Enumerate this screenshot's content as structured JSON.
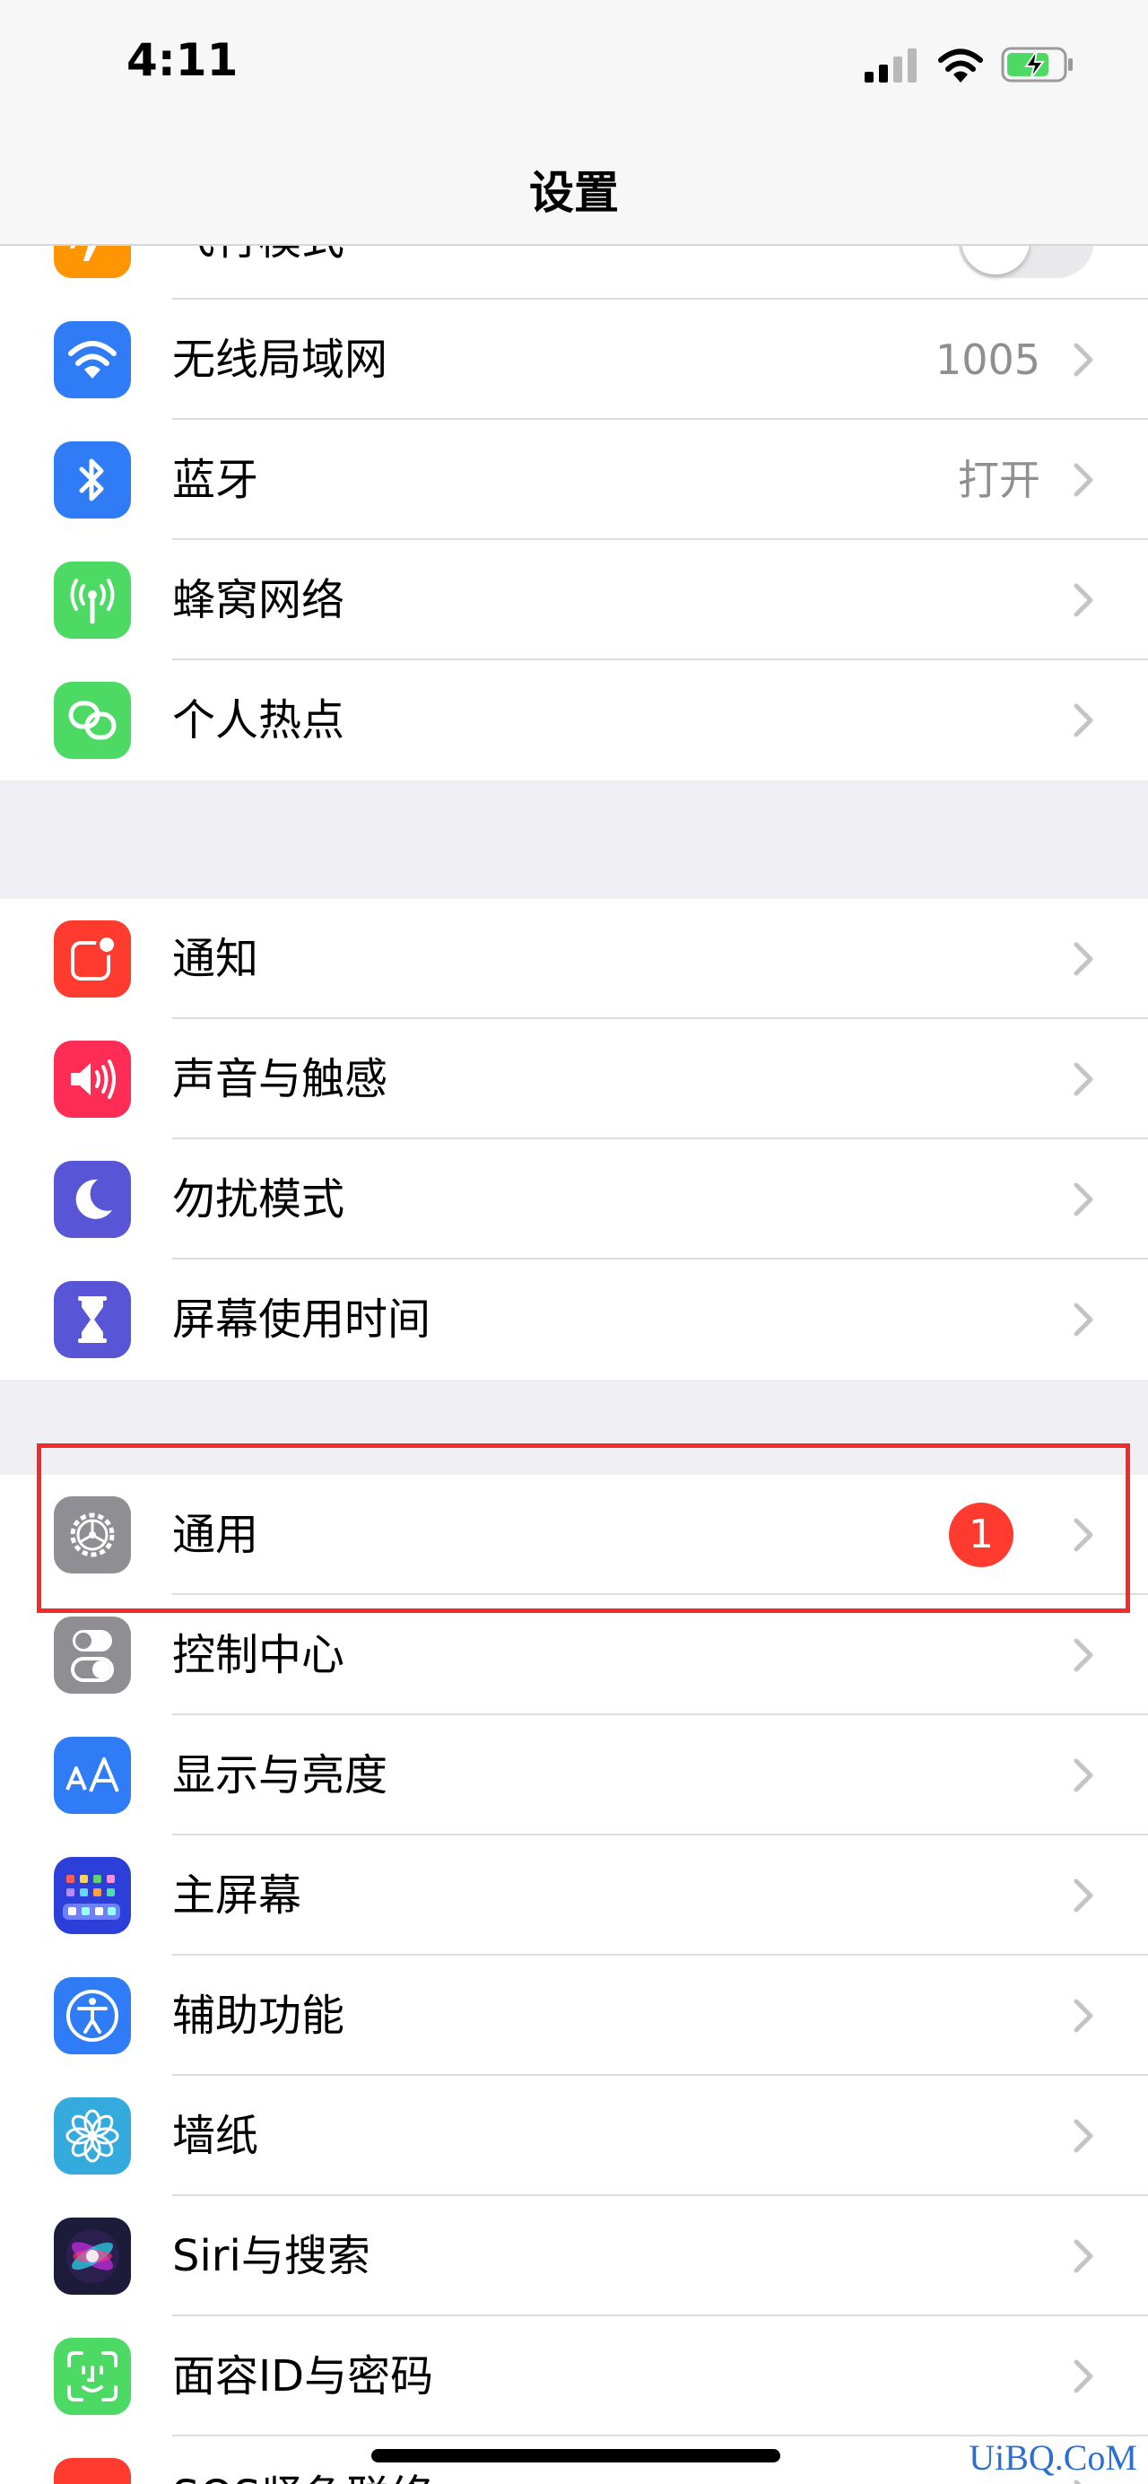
{
  "status_bar": {
    "time": "4:11"
  },
  "nav": {
    "title": "设置"
  },
  "groups": [
    {
      "items": [
        {
          "label": "飞行模式",
          "icon": "airplane-icon",
          "color": "#ff9500",
          "accessory": "toggle",
          "toggle_on": false
        },
        {
          "label": "无线局域网",
          "icon": "wifi-icon",
          "color": "#2f7cf6",
          "value": "1005"
        },
        {
          "label": "蓝牙",
          "icon": "bluetooth-icon",
          "color": "#2f7cf6",
          "value": "打开"
        },
        {
          "label": "蜂窝网络",
          "icon": "antenna-icon",
          "color": "#4cd964"
        },
        {
          "label": "个人热点",
          "icon": "hotspot-chain-icon",
          "color": "#4cd964"
        }
      ]
    },
    {
      "items": [
        {
          "label": "通知",
          "icon": "notifications-icon",
          "color": "#ff3b30"
        },
        {
          "label": "声音与触感",
          "icon": "speaker-icon",
          "color": "#ff2d55"
        },
        {
          "label": "勿扰模式",
          "icon": "moon-icon",
          "color": "#5856d6"
        },
        {
          "label": "屏幕使用时间",
          "icon": "hourglass-icon",
          "color": "#5856d6"
        }
      ]
    },
    {
      "items": [
        {
          "label": "通用",
          "icon": "gear-icon",
          "color": "#8e8e93",
          "badge": "1"
        },
        {
          "label": "控制中心",
          "icon": "switches-icon",
          "color": "#8e8e93"
        },
        {
          "label": "显示与亮度",
          "icon": "text-size-icon",
          "color": "#2f7cf6"
        },
        {
          "label": "主屏幕",
          "icon": "home-screen-grid-icon",
          "color": "#2c3fd8"
        },
        {
          "label": "辅助功能",
          "icon": "accessibility-icon",
          "color": "#2f7cf6"
        },
        {
          "label": "墙纸",
          "icon": "flower-icon",
          "color": "#35aadc"
        },
        {
          "label": "Siri与搜索",
          "icon": "siri-icon",
          "color": "#1c1c3a"
        },
        {
          "label": "面容ID与密码",
          "icon": "face-id-icon",
          "color": "#4cd964"
        },
        {
          "label": "SOS紧急联络",
          "icon": "sos-icon",
          "color": "#ff3b30"
        }
      ]
    }
  ],
  "highlighted_item": "通用",
  "watermark": "UiBQ.CoM"
}
